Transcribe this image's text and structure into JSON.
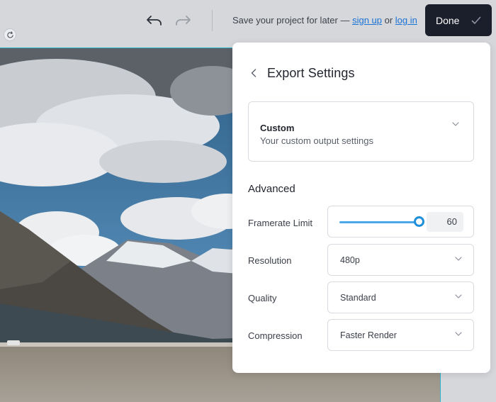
{
  "topbar": {
    "save_prefix": "Save your project for later — ",
    "sign_up": "sign up",
    "or_text": " or ",
    "log_in": "log in",
    "done_label": "Done"
  },
  "icons": {
    "undo": "undo-arrow-icon",
    "redo": "redo-arrow-icon",
    "done": "check-icon",
    "rotate": "rotate-icon",
    "back": "chevron-left-icon",
    "dropdown": "chevron-down-icon"
  },
  "panel": {
    "title": "Export Settings",
    "preset": {
      "name": "Custom",
      "description": "Your custom output settings"
    },
    "advanced_title": "Advanced",
    "framerate": {
      "label": "Framerate Limit",
      "value": "60"
    },
    "resolution": {
      "label": "Resolution",
      "value": "480p"
    },
    "quality": {
      "label": "Quality",
      "value": "Standard"
    },
    "compression": {
      "label": "Compression",
      "value": "Faster Render"
    }
  },
  "colors": {
    "accent": "#1f8fd9",
    "done_bg": "#1b1e2b",
    "link": "#1a73d6",
    "selection_border": "#31b3ce"
  }
}
